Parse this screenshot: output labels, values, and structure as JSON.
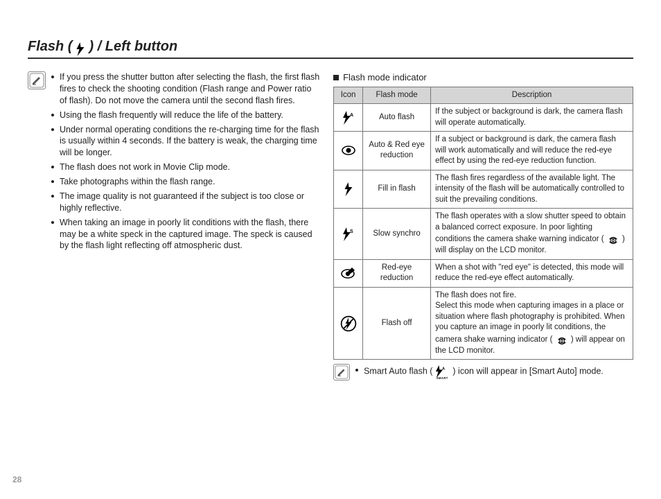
{
  "page_number": "28",
  "title": {
    "pre": "Flash (",
    "post": ") / Left button"
  },
  "icons": {
    "flash": "flash-icon",
    "pencil": "pencil-note-icon",
    "shake": "camera-shake-icon",
    "flash_auto_smart": "smart-auto-flash-icon"
  },
  "bullets": [
    "If you press the shutter button after selecting the flash, the first flash fires to check the shooting condition (Flash range and Power ratio of flash). Do not move the camera until the second flash fires.",
    "Using the flash frequently will reduce the life of the battery.",
    "Under normal operating conditions the re-charging time for the flash is usually within 4 seconds. If the battery is weak, the charging time will be longer.",
    "The flash does not work in Movie Clip mode.",
    "Take photographs within the flash range.",
    "The image quality is not guaranteed if the subject is too close or highly reflective.",
    "When taking an image in poorly lit conditions with the flash, there may be a white speck in the captured image. The speck is caused by the flash light reflecting off atmospheric dust."
  ],
  "indicator_heading": "Flash mode indicator",
  "table": {
    "headers": {
      "icon": "Icon",
      "mode": "Flash mode",
      "desc": "Description"
    },
    "rows": [
      {
        "icon": "flash-auto-icon",
        "mode": "Auto flash",
        "desc": "If the subject or background is dark, the camera flash will operate automatically."
      },
      {
        "icon": "red-eye-icon",
        "mode": "Auto & Red eye reduction",
        "desc": "If a subject or background is dark, the camera flash will work automatically and will reduce the red-eye effect by using the red-eye reduction function."
      },
      {
        "icon": "flash-icon",
        "mode": "Fill in flash",
        "desc": "The flash fires regardless of the available light. The intensity of the flash will be automatically controlled to suit the prevailing conditions."
      },
      {
        "icon": "slow-synchro-icon",
        "mode": "Slow synchro",
        "desc_pre": "The flash operates with a slow shutter speed to obtain a balanced correct exposure. In poor lighting conditions the camera shake warning indicator (",
        "desc_post": ") will display on the LCD monitor."
      },
      {
        "icon": "red-eye-reduction-icon",
        "mode": "Red-eye reduction",
        "desc": "When a shot with \"red eye\" is detected, this mode will reduce the red-eye effect automatically."
      },
      {
        "icon": "flash-off-icon",
        "mode": "Flash off",
        "desc_pre": "The flash does not fire.\nSelect this mode when capturing images in a place or situation where flash photography is prohibited. When you capture an image in poorly lit conditions, the camera shake warning indicator (",
        "desc_post": ") will appear on the LCD monitor."
      }
    ]
  },
  "footnote": {
    "pre": "Smart Auto flash (",
    "post": ") icon will appear in [Smart Auto] mode."
  }
}
